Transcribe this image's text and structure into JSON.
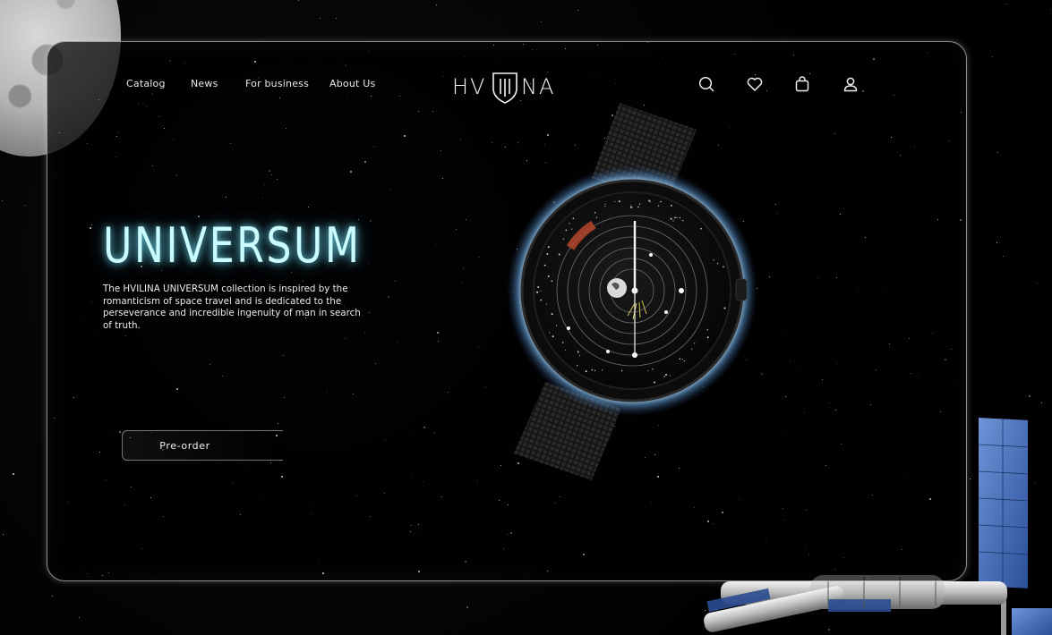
{
  "nav": {
    "links": [
      {
        "label": "Catalog"
      },
      {
        "label": "News"
      },
      {
        "label": "For business"
      },
      {
        "label": "About Us"
      }
    ],
    "icons": [
      "search-icon",
      "heart-icon",
      "bag-icon",
      "user-icon"
    ]
  },
  "brand": {
    "logo_left": "HV",
    "logo_right": "NA"
  },
  "hero": {
    "title": "UNIVERSUM",
    "description": "The HVILINA UNIVERSUM collection is inspired by the romanticism of space travel and is dedicated to the perseverance and incredible ingenuity of man in search of truth.",
    "cta_label": "Pre-order"
  },
  "colors": {
    "accent": "#c9fbff",
    "glow": "#78ebff",
    "background": "#000000",
    "watch_accent": "#b5462a"
  }
}
